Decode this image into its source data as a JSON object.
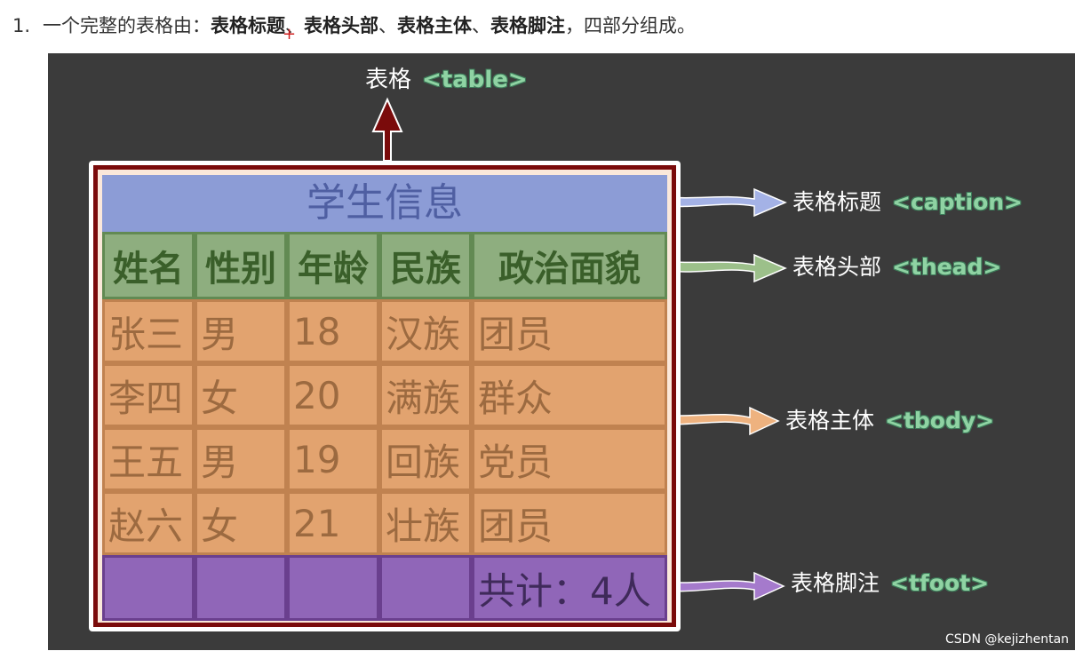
{
  "intro": {
    "num": "1.",
    "text_pre": "一个完整的表格由：",
    "item1": "表格标题",
    "sep1": "、",
    "item2": "表格头部",
    "sep2": "、",
    "item3": "表格主体",
    "sep3": "、",
    "item4": "表格脚注",
    "text_post": "，四部分组成。"
  },
  "diagram": {
    "top_label": "表格",
    "top_tag": "<table>",
    "caption": "学生信息",
    "headers": [
      "姓名",
      "性别",
      "年龄",
      "民族",
      "政治面貌"
    ],
    "rows": [
      [
        "张三",
        "男",
        "18",
        "汉族",
        "团员"
      ],
      [
        "李四",
        "女",
        "20",
        "满族",
        "群众"
      ],
      [
        "王五",
        "男",
        "19",
        "回族",
        "党员"
      ],
      [
        "赵六",
        "女",
        "21",
        "壮族",
        "团员"
      ]
    ],
    "footer": [
      "",
      "",
      "",
      "",
      "共计：4人"
    ],
    "labels": [
      {
        "text": "表格标题",
        "tag": "<caption>"
      },
      {
        "text": "表格头部",
        "tag": "<thead>"
      },
      {
        "text": "表格主体",
        "tag": "<tbody>"
      },
      {
        "text": "表格脚注",
        "tag": "<tfoot>"
      }
    ]
  },
  "watermark": "CSDN @kejizhentan",
  "colors": {
    "background": "#3b3b3b",
    "caption": "#8c9cd6",
    "thead": "#8eae7f",
    "tbody": "#e2a36f",
    "tfoot": "#9066b8",
    "frame": "#7a0b0b",
    "tag": "#8fd3a3"
  }
}
